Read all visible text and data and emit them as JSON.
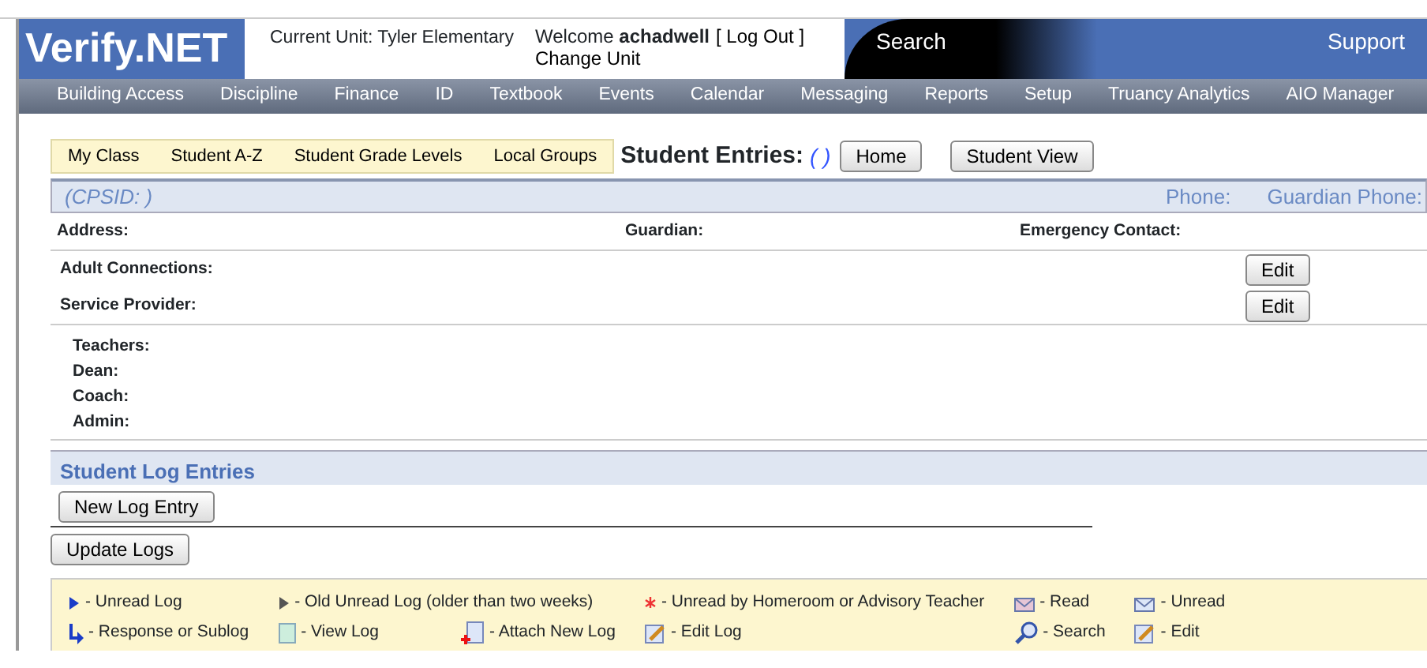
{
  "header": {
    "logo": "Verify.NET",
    "current_unit": "Current Unit: Tyler Elementary",
    "welcome": "Welcome",
    "username": "achadwell",
    "logout": "[ Log Out ]",
    "change_unit": "Change Unit",
    "search": "Search",
    "support": "Support"
  },
  "nav": [
    "Building Access",
    "Discipline",
    "Finance",
    "ID",
    "Textbook",
    "Events",
    "Calendar",
    "Messaging",
    "Reports",
    "Setup",
    "Truancy Analytics",
    "AIO Manager"
  ],
  "tabs": [
    {
      "label": "My Class",
      "selected": false
    },
    {
      "label": "Student A-Z",
      "selected": false
    },
    {
      "label": "Student Grade Levels",
      "selected": false
    },
    {
      "label": "Local Groups",
      "selected": false
    }
  ],
  "page_title": "Student Entries:",
  "title_suffix": "( )",
  "title_buttons": [
    "Home",
    "Student View"
  ],
  "student_bar": {
    "cpsid": "(CPSID: )",
    "phone": "Phone:",
    "guardian_phone": "Guardian Phone:"
  },
  "info": [
    "Address:",
    "Guardian:",
    "Emergency Contact:"
  ],
  "connections": [
    {
      "label": "Adult Connections:",
      "button": "Edit"
    },
    {
      "label": "Service Provider:",
      "button": "Edit"
    }
  ],
  "staff": [
    "Teachers:",
    "Dean:",
    "Coach:",
    "Admin:"
  ],
  "log": {
    "title": "Student Log Entries",
    "new_button": "New Log Entry",
    "update_button": "Update Logs"
  },
  "legend": [
    {
      "kind": "unread",
      "label": "- Unread Log"
    },
    {
      "kind": "old",
      "label": "- Old Unread Log (older than two weeks)"
    },
    {
      "kind": "star",
      "label": "- Unread by Homeroom or Advisory Teacher"
    },
    {
      "kind": "read",
      "label": "- Read"
    },
    {
      "kind": "envelope",
      "label": "- Unread"
    },
    {
      "kind": "response",
      "label": "- Response or Sublog"
    },
    {
      "kind": "view",
      "label": "- View Log"
    },
    {
      "kind": "attach",
      "label": "- Attach New Log"
    },
    {
      "kind": "edit",
      "label": "- Edit Log"
    },
    {
      "kind": "search",
      "label": "- Search"
    },
    {
      "kind": "edit",
      "label": "- Edit"
    }
  ]
}
